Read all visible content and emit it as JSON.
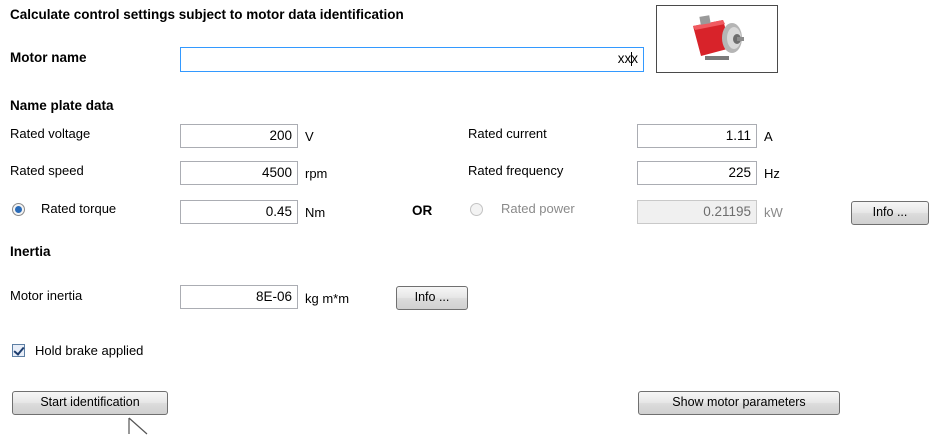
{
  "title": "Calculate control settings subject to motor data identification",
  "motor_name": {
    "label": "Motor name",
    "value": "xxx"
  },
  "motor_image": "motor-icon",
  "name_plate": {
    "heading": "Name plate data",
    "rated_voltage": {
      "label": "Rated voltage",
      "value": "200",
      "unit": "V"
    },
    "rated_speed": {
      "label": "Rated speed",
      "value": "4500",
      "unit": "rpm"
    },
    "rated_torque": {
      "label": "Rated torque",
      "value": "0.45",
      "unit": "Nm",
      "selected": true
    },
    "or_label": "OR",
    "rated_current": {
      "label": "Rated current",
      "value": "1.11",
      "unit": "A"
    },
    "rated_frequency": {
      "label": "Rated frequency",
      "value": "225",
      "unit": "Hz"
    },
    "rated_power": {
      "label": "Rated power",
      "value": "0.21195",
      "unit": "kW",
      "selected": false
    },
    "info_button": "Info ..."
  },
  "inertia": {
    "heading": "Inertia",
    "motor_inertia": {
      "label": "Motor inertia",
      "value": "8E-06",
      "unit": "kg m*m"
    },
    "info_button": "Info ..."
  },
  "hold_brake": {
    "label": "Hold brake applied",
    "checked": true
  },
  "buttons": {
    "start": "Start identification",
    "show_params": "Show motor parameters"
  },
  "colors": {
    "focus_border": "#3399ff",
    "motor_red": "#d8232a"
  }
}
